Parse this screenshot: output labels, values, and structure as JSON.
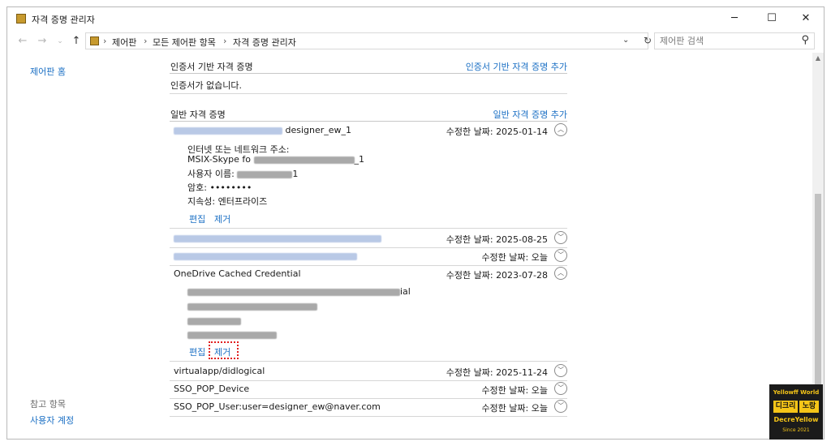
{
  "window": {
    "title": "자격 증명 관리자",
    "controls": {
      "minimize": "─",
      "maximize": "☐",
      "close": "✕"
    }
  },
  "nav": {
    "back": "←",
    "forward": "→",
    "dropdown": "⌄",
    "up": "↑"
  },
  "breadcrumb": {
    "items": [
      "제어판",
      "모든 제어판 항목",
      "자격 증명 관리자"
    ],
    "separator": "›",
    "dropdown": "⌄",
    "refresh": "↻"
  },
  "search": {
    "placeholder": "제어판 검색",
    "icon": "search-icon"
  },
  "sidebar": {
    "home_link": "제어판 홈",
    "see_also_heading": "참고 항목",
    "see_also_items": [
      "사용자 계정"
    ]
  },
  "cert_section": {
    "title": "인증서 기반 자격 증명",
    "add_link": "인증서 기반 자격 증명 추가",
    "empty_text": "인증서가 없습니다."
  },
  "generic_section": {
    "title": "일반 자격 증명",
    "add_link": "일반 자격 증명 추가"
  },
  "credentials": [
    {
      "name": "designer_ew_1",
      "modified_label": "수정한 날짜:",
      "modified_value": "2025-01-14",
      "expanded": true,
      "details": {
        "address_label": "인터넷 또는 네트워크 주소:",
        "address_value": "MSIX-Skype fo",
        "address_tail": "_1",
        "user_label": "사용자 이름:",
        "user_tail": "1",
        "password_label": "암호:",
        "password_value": "••••••••",
        "persistence_label": "지속성:",
        "persistence_value": "엔터프라이즈"
      },
      "edit_link": "편집",
      "remove_link": "제거"
    },
    {
      "name": "",
      "modified_label": "수정한 날짜:",
      "modified_value": "2025-08-25"
    },
    {
      "name": "",
      "modified_label": "수정한 날짜:",
      "modified_value": "오늘"
    },
    {
      "name": "OneDrive Cached Credential",
      "modified_label": "수정한 날짜:",
      "modified_value": "2023-07-28",
      "expanded": true,
      "detail_tail": "ial",
      "edit_link": "편집",
      "remove_link": "제거",
      "remove_highlight_color": "#e02020"
    },
    {
      "name": "virtualapp/didlogical",
      "modified_label": "수정한 날짜:",
      "modified_value": "2025-11-24"
    },
    {
      "name": "SSO_POP_Device",
      "modified_label": "수정한 날짜:",
      "modified_value": "오늘"
    },
    {
      "name": "SSO_POP_User:user=designer_ew@naver.com",
      "modified_label": "수정한 날짜:",
      "modified_value": "오늘"
    }
  ],
  "chevrons": {
    "up": "︿",
    "down": "﹀"
  },
  "watermark": {
    "line1": "Yellowff World",
    "box1": "디크리",
    "box2": "노랑",
    "line2": "DecreYellow",
    "line3": "Since 2021"
  },
  "colors": {
    "link": "#1a6fc4",
    "folder": "#c79a2e",
    "brand_bg": "#1b1b1b",
    "brand_accent": "#f5c518"
  }
}
